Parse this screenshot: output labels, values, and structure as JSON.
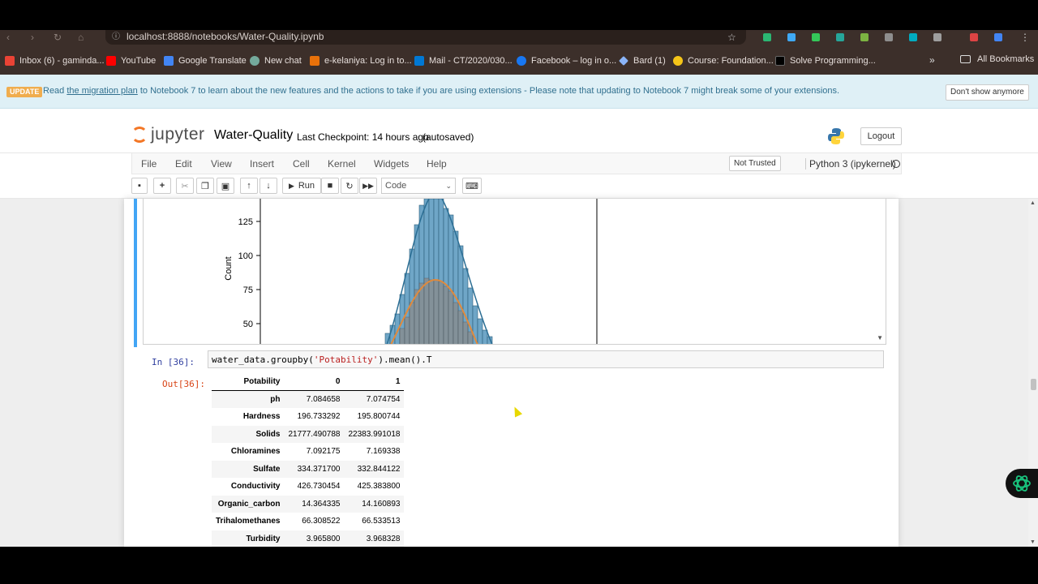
{
  "browser": {
    "url": "localhost:8888/notebooks/Water-Quality.ipynb",
    "bookmarks": [
      {
        "label": "Inbox (6) - gaminda...",
        "color": "#ea4335"
      },
      {
        "label": "YouTube",
        "color": "#ff0000"
      },
      {
        "label": "Google Translate",
        "color": "#4285f4"
      },
      {
        "label": "New chat",
        "color": "#74aa9c"
      },
      {
        "label": "e-kelaniya: Log in to...",
        "color": "#e8710a"
      },
      {
        "label": "Mail - CT/2020/030...",
        "color": "#0078d4"
      },
      {
        "label": "Facebook – log in o...",
        "color": "#1877f2"
      },
      {
        "label": "Bard (1)",
        "color": "#8ab4f8"
      },
      {
        "label": "Course: Foundation...",
        "color": "#f5c518"
      },
      {
        "label": "Solve Programming...",
        "color": "#000000"
      }
    ],
    "all_bookmarks": "All Bookmarks"
  },
  "banner": {
    "badge": "UPDATE",
    "text_before": "Read",
    "link": "the migration plan",
    "text_after": "to Notebook 7 to learn about the new features and the actions to take if you are using extensions - Please note that updating to Notebook 7 might break some of your extensions.",
    "dismiss": "Don't show anymore"
  },
  "header": {
    "logo_text": "jupyter",
    "notebook_name": "Water-Quality",
    "checkpoint": "Last Checkpoint: 14 hours ago",
    "autosave": "(autosaved)",
    "logout": "Logout"
  },
  "menu": {
    "items": [
      "File",
      "Edit",
      "View",
      "Insert",
      "Cell",
      "Kernel",
      "Widgets",
      "Help"
    ],
    "trust": "Not Trusted",
    "kernel": "Python 3 (ipykernel)"
  },
  "toolbar": {
    "run_label": "Run",
    "cell_type": "Code"
  },
  "plot_fragment": {
    "ylabel": "Count",
    "yticks": [
      "125",
      "100",
      "75",
      "50"
    ]
  },
  "cell": {
    "in_prompt": "In [36]:",
    "out_prompt": "Out[36]:",
    "code_prefix": "water_data.groupby(",
    "code_string": "'Potability'",
    "code_suffix": ").mean().T"
  },
  "table": {
    "index_name": "Potability",
    "columns": [
      "0",
      "1"
    ],
    "rows": [
      {
        "label": "ph",
        "v0": "7.084658",
        "v1": "7.074754"
      },
      {
        "label": "Hardness",
        "v0": "196.733292",
        "v1": "195.800744"
      },
      {
        "label": "Solids",
        "v0": "21777.490788",
        "v1": "22383.991018"
      },
      {
        "label": "Chloramines",
        "v0": "7.092175",
        "v1": "7.169338"
      },
      {
        "label": "Sulfate",
        "v0": "334.371700",
        "v1": "332.844122"
      },
      {
        "label": "Conductivity",
        "v0": "426.730454",
        "v1": "425.383800"
      },
      {
        "label": "Organic_carbon",
        "v0": "14.364335",
        "v1": "14.160893"
      },
      {
        "label": "Trihalomethanes",
        "v0": "66.308522",
        "v1": "66.533513"
      },
      {
        "label": "Turbidity",
        "v0": "3.965800",
        "v1": "3.968328"
      }
    ]
  }
}
